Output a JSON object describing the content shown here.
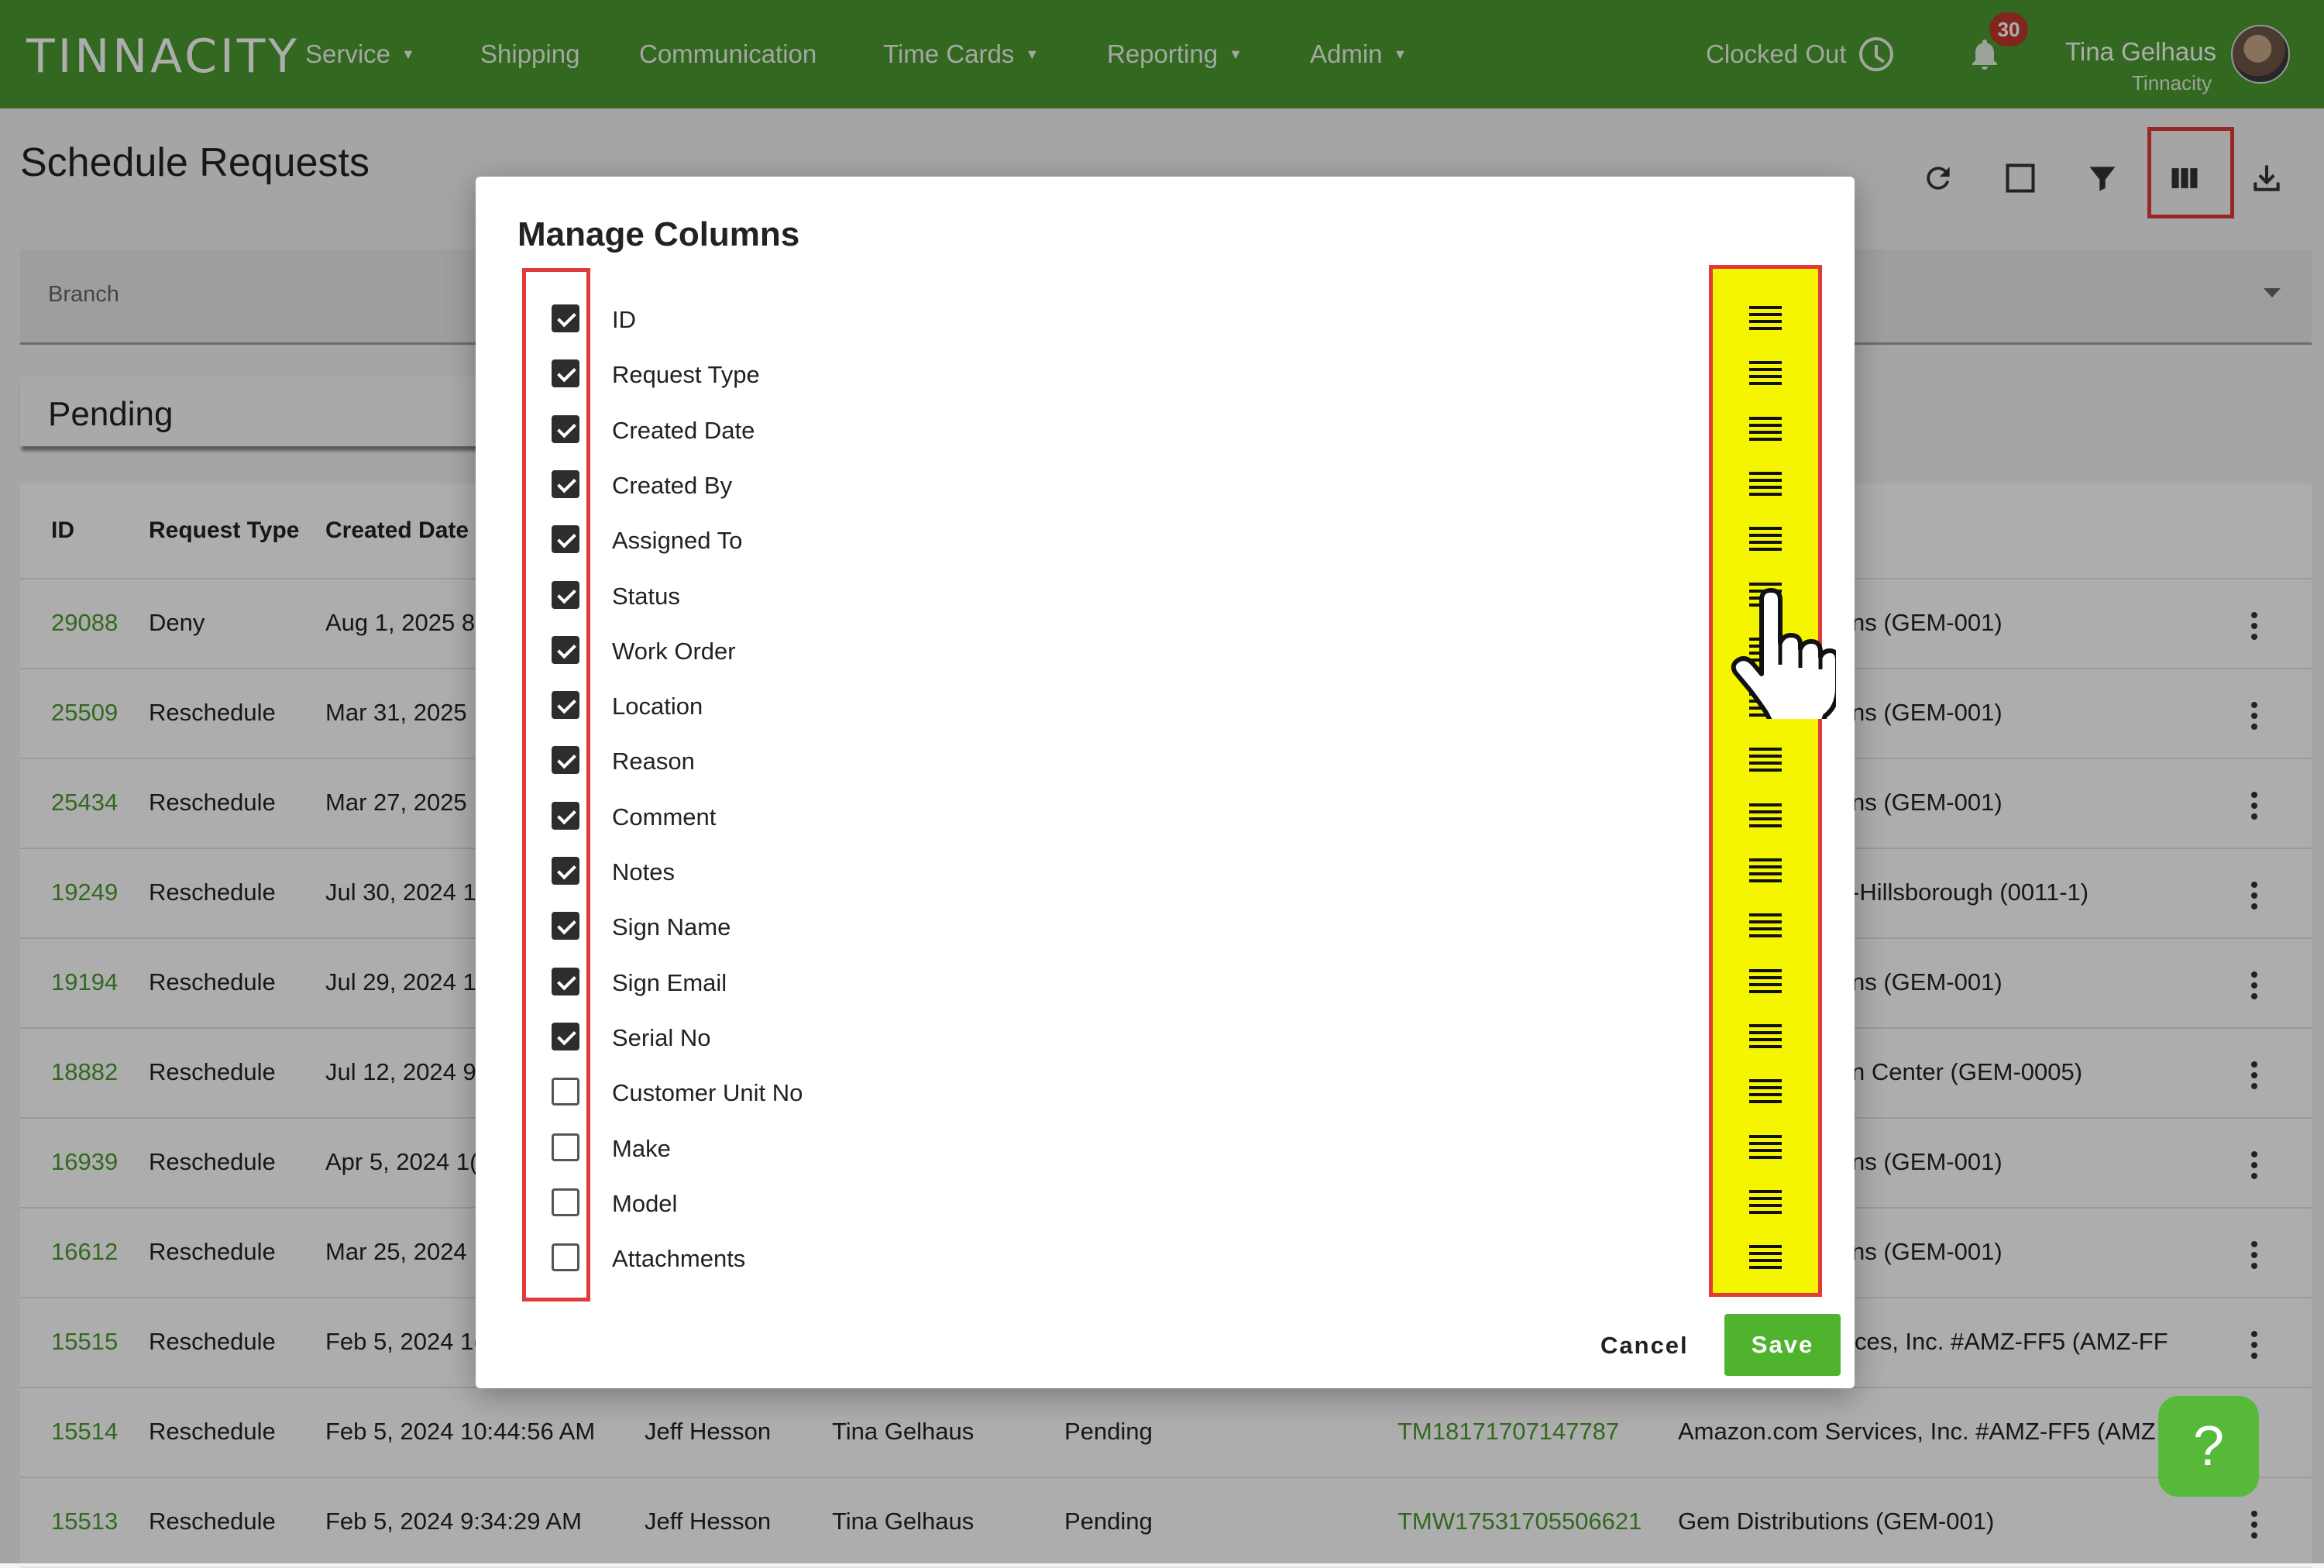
{
  "app": {
    "logo": "TINNACITY",
    "nav": [
      {
        "label": "Service",
        "has_menu": true
      },
      {
        "label": "Shipping",
        "has_menu": false
      },
      {
        "label": "Communication",
        "has_menu": false
      },
      {
        "label": "Time Cards",
        "has_menu": true
      },
      {
        "label": "Reporting",
        "has_menu": true
      },
      {
        "label": "Admin",
        "has_menu": true
      }
    ],
    "clock_status": "Clocked Out",
    "notification_count": "30",
    "user_name": "Tina Gelhaus",
    "user_org": "Tinnacity"
  },
  "page": {
    "title": "Schedule Requests",
    "toolbar_icons": [
      "refresh-icon",
      "select-icon",
      "filter-icon",
      "columns-icon",
      "download-icon"
    ],
    "branch_label": "Branch",
    "tab": "Pending",
    "columns": [
      "ID",
      "Request Type",
      "Created Date"
    ],
    "rows": [
      {
        "id": "29088",
        "type": "Deny",
        "date": "Aug 1, 2025 8",
        "loc": "ns (GEM-001)"
      },
      {
        "id": "25509",
        "type": "Reschedule",
        "date": "Mar 31, 2025",
        "loc": "ns (GEM-001)"
      },
      {
        "id": "25434",
        "type": "Reschedule",
        "date": "Mar 27, 2025",
        "loc": "ns (GEM-001)"
      },
      {
        "id": "19249",
        "type": "Reschedule",
        "date": "Jul 30, 2024 1",
        "loc": "-Hillsborough (0011-1)"
      },
      {
        "id": "19194",
        "type": "Reschedule",
        "date": "Jul 29, 2024 1",
        "loc": "ns (GEM-001)"
      },
      {
        "id": "18882",
        "type": "Reschedule",
        "date": "Jul 12, 2024 9",
        "loc": "n Center (GEM-0005)"
      },
      {
        "id": "16939",
        "type": "Reschedule",
        "date": "Apr 5, 2024 1(",
        "loc": "ns (GEM-001)"
      },
      {
        "id": "16612",
        "type": "Reschedule",
        "date": "Mar 25, 2024",
        "loc": "ns (GEM-001)"
      },
      {
        "id": "15515",
        "type": "Reschedule",
        "date": "Feb 5, 2024 1(",
        "loc": "ervices, Inc. #AMZ-FF5 (AMZ-FF"
      },
      {
        "id": "15514",
        "type": "Reschedule",
        "date": "Feb 5, 2024 10:44:56 AM",
        "created_by": "Jeff Hesson",
        "assigned_to": "Tina Gelhaus",
        "status": "Pending",
        "work_order": "TM18171707147787",
        "loc": "Amazon.com Services, Inc. #AMZ-FF5 (AMZ"
      },
      {
        "id": "15513",
        "type": "Reschedule",
        "date": "Feb 5, 2024 9:34:29 AM",
        "created_by": "Jeff Hesson",
        "assigned_to": "Tina Gelhaus",
        "status": "Pending",
        "work_order": "TMW17531705506621",
        "loc": "Gem Distributions (GEM-001)"
      }
    ],
    "help_label": "?"
  },
  "modal": {
    "title": "Manage Columns",
    "columns": [
      {
        "label": "ID",
        "checked": true
      },
      {
        "label": "Request Type",
        "checked": true
      },
      {
        "label": "Created Date",
        "checked": true
      },
      {
        "label": "Created By",
        "checked": true
      },
      {
        "label": "Assigned To",
        "checked": true
      },
      {
        "label": "Status",
        "checked": true
      },
      {
        "label": "Work Order",
        "checked": true
      },
      {
        "label": "Location",
        "checked": true
      },
      {
        "label": "Reason",
        "checked": true
      },
      {
        "label": "Comment",
        "checked": true
      },
      {
        "label": "Notes",
        "checked": true
      },
      {
        "label": "Sign Name",
        "checked": true
      },
      {
        "label": "Sign Email",
        "checked": true
      },
      {
        "label": "Serial No",
        "checked": true
      },
      {
        "label": "Customer Unit No",
        "checked": false
      },
      {
        "label": "Make",
        "checked": false
      },
      {
        "label": "Model",
        "checked": false
      },
      {
        "label": "Attachments",
        "checked": false
      }
    ],
    "cancel_label": "Cancel",
    "save_label": "Save"
  },
  "colors": {
    "brand_green": "#4a9a2f",
    "save_green": "#4fb32e",
    "highlight_red": "#e03a3a",
    "highlight_yellow": "#f5f500"
  }
}
